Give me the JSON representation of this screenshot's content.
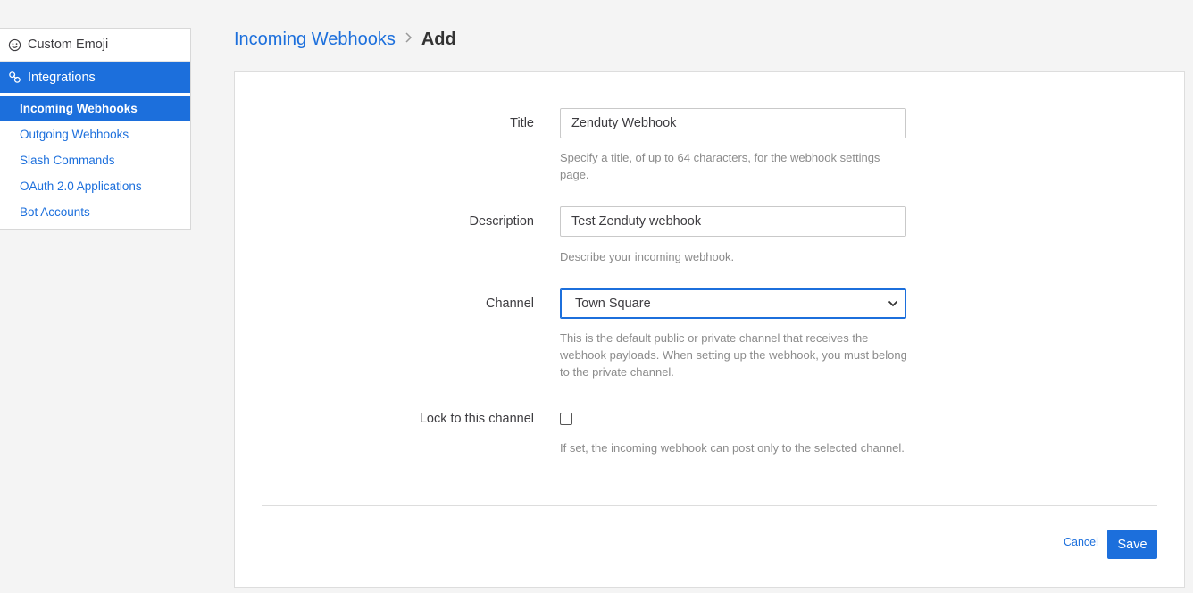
{
  "sidebar": {
    "sections": [
      {
        "label": "Custom Emoji",
        "icon": "smiley-icon"
      },
      {
        "label": "Integrations",
        "icon": "link-icon"
      }
    ],
    "sub_items": [
      {
        "label": "Incoming Webhooks"
      },
      {
        "label": "Outgoing Webhooks"
      },
      {
        "label": "Slash Commands"
      },
      {
        "label": "OAuth 2.0 Applications"
      },
      {
        "label": "Bot Accounts"
      }
    ]
  },
  "breadcrumb": {
    "parent": "Incoming Webhooks",
    "current": "Add"
  },
  "form": {
    "title": {
      "label": "Title",
      "value": "Zenduty Webhook",
      "help": "Specify a title, of up to 64 characters, for the webhook settings page."
    },
    "description": {
      "label": "Description",
      "value": "Test Zenduty webhook",
      "help": "Describe your incoming webhook."
    },
    "channel": {
      "label": "Channel",
      "value": "Town Square",
      "help": "This is the default public or private channel that receives the webhook payloads. When setting up the webhook, you must belong to the private channel."
    },
    "lock": {
      "label": "Lock to this channel",
      "checked": false,
      "help": "If set, the incoming webhook can post only to the selected channel."
    }
  },
  "actions": {
    "cancel": "Cancel",
    "save": "Save"
  },
  "colors": {
    "accent": "#1c6fdc",
    "background": "#f4f4f4"
  }
}
